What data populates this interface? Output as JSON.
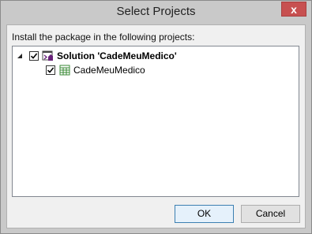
{
  "window": {
    "title": "Select Projects",
    "close_label": "x"
  },
  "instruction": "Install the package in the following projects:",
  "tree": {
    "root": {
      "label": "Solution 'CadeMeuMedico'",
      "checked": true,
      "expanded": true
    },
    "children": [
      {
        "label": "CadeMeuMedico",
        "checked": true
      }
    ]
  },
  "buttons": {
    "ok": "OK",
    "cancel": "Cancel"
  }
}
